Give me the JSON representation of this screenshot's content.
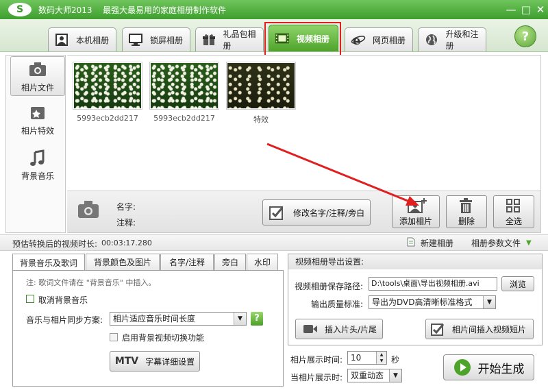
{
  "titlebar": {
    "logo_text": "S",
    "app_title": "数码大师2013",
    "slogan": "最强大最易用的家庭相册制作软件",
    "min_symbol": "—",
    "max_symbol": "□",
    "close_symbol": "✕"
  },
  "main_tabs": [
    {
      "label": "本机相册",
      "icon": "person-frame-icon"
    },
    {
      "label": "锁屏相册",
      "icon": "monitor-icon"
    },
    {
      "label": "礼品包相册",
      "icon": "gift-icon"
    },
    {
      "label": "视频相册",
      "icon": "film-strip-icon",
      "active": true
    },
    {
      "label": "网页相册",
      "icon": "ie-icon"
    },
    {
      "label": "升级和注册",
      "icon": "globe-icon"
    }
  ],
  "help_label": "?",
  "sidebar": {
    "items": [
      {
        "label": "相片文件",
        "icon": "camera-icon",
        "active": true
      },
      {
        "label": "相片特效",
        "icon": "effects-icon"
      },
      {
        "label": "背景音乐",
        "icon": "music-note-icon"
      }
    ]
  },
  "photos": [
    {
      "label": "5993ecb2dd217"
    },
    {
      "label": "5993ecb2dd217"
    },
    {
      "label": "特效"
    }
  ],
  "info_bar": {
    "name_label": "名字:",
    "note_label": "注释:",
    "edit_button": "修改名字/注释/旁白",
    "add_photo_button": "添加相片",
    "delete_button": "删除",
    "select_all_button": "全选"
  },
  "duration": {
    "label": "预估转换后的视频时长:",
    "value": "00:03:17.280",
    "new_album": "新建相册",
    "album_params": "相册参数文件"
  },
  "settings_tabs": [
    {
      "label": "背景音乐及歌词",
      "active": true
    },
    {
      "label": "背景颜色及图片"
    },
    {
      "label": "名字/注释"
    },
    {
      "label": "旁白"
    },
    {
      "label": "水印"
    }
  ],
  "music_settings": {
    "lyrics_note": "注: 歌词文件请在 \"背景音乐\" 中插入。",
    "cancel_music": "取消背景音乐",
    "sync_label": "音乐与相片同步方案:",
    "sync_value": "相片适应音乐时间长度",
    "help": "?",
    "video_switch": "启用背景视频切换功能",
    "mtv_label": "MTV",
    "subtitle_settings": "字幕详细设置"
  },
  "export": {
    "header": "视频相册导出设置:",
    "save_path_label": "视频相册保存路径:",
    "save_path_value": "D:\\tools\\桌面\\导出视频相册.avi",
    "browse": "浏览",
    "quality_label": "输出质量标准:",
    "quality_value": "导出为DVD高清晰标准格式",
    "insert_head_tail": "插入片头/片尾",
    "insert_clip": "相片间插入视频短片"
  },
  "display": {
    "time_label": "相片展示时间:",
    "time_value": "10",
    "seconds": "秒",
    "mode_label": "当相片展示时:",
    "mode_value": "双重动态"
  },
  "start_button": "开始生成",
  "colors": {
    "brand_green": "#4ea32a",
    "highlight_red": "#e02020"
  }
}
